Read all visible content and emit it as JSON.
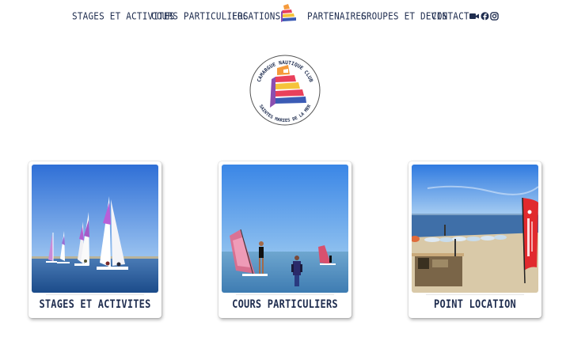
{
  "nav": {
    "items": [
      {
        "label": "STAGES ET ACTIVITES"
      },
      {
        "label": "COURS PARTICULIERS"
      },
      {
        "label": "LOCATIONS"
      },
      {
        "label": "PARTENAIRES"
      },
      {
        "label": "GROUPES ET DEVIS"
      },
      {
        "label": "CONTACT"
      }
    ],
    "social_icons": [
      "video-camera-icon",
      "facebook-icon",
      "instagram-icon"
    ]
  },
  "brand": {
    "text_top": "CAMARGUE NAUTIQUE CLUB",
    "text_bottom": "SAINTES MARIES DE LA MER"
  },
  "cards": [
    {
      "title": "STAGES ET ACTIVITES",
      "photo": "catamarans-sailing"
    },
    {
      "title": "COURS PARTICULIERS",
      "photo": "windsurf-lesson"
    },
    {
      "title": "POINT LOCATION",
      "photo": "beach-rental-point"
    }
  ],
  "colors": {
    "text": "#1f2d4f",
    "logo_red": "#e9405b",
    "logo_orange": "#f59a3a",
    "logo_yellow": "#f5c43a",
    "logo_blue": "#3b5bb5",
    "logo_purple": "#8a4fb0"
  }
}
